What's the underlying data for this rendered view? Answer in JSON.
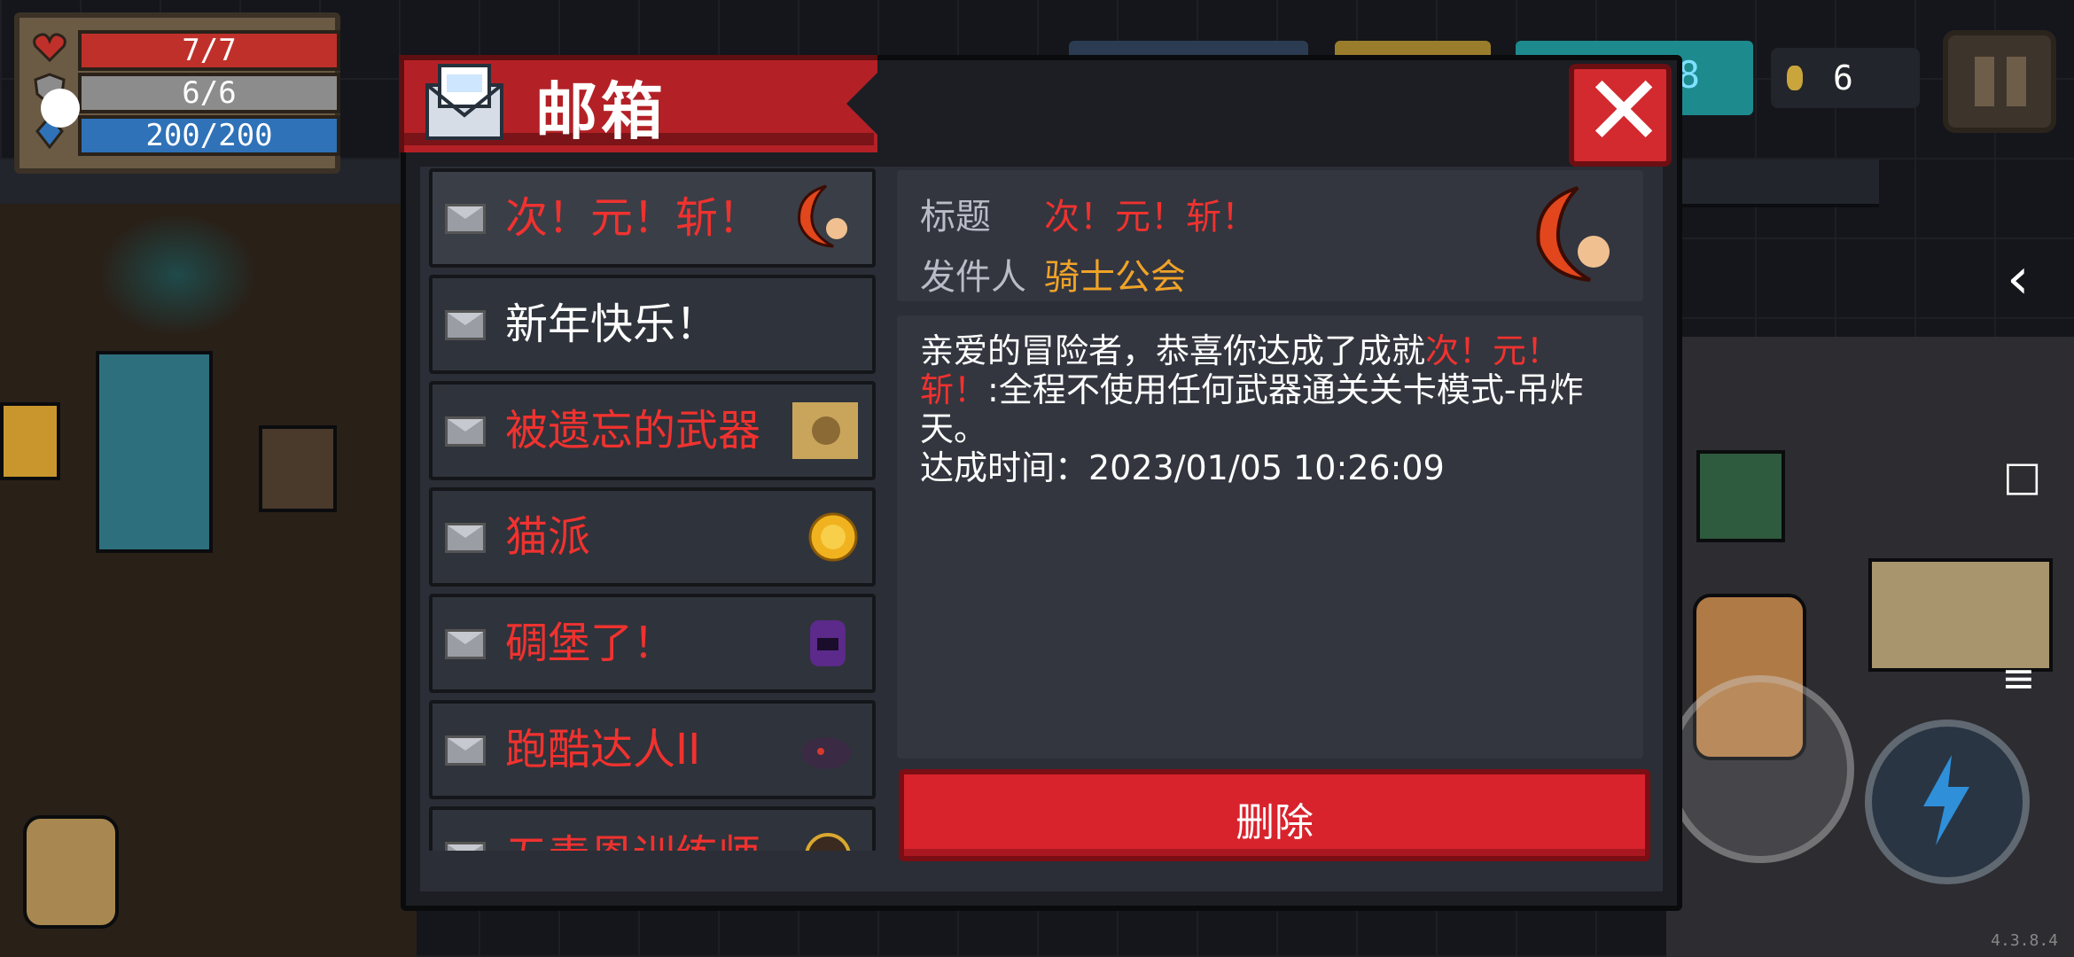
{
  "hud": {
    "hp": "7/7",
    "armor": "6/6",
    "energy": "200/200",
    "coins": "6",
    "partial_counter": "8",
    "hp_icon": "heart-icon",
    "armor_icon": "shield-icon",
    "energy_icon": "crystal-icon"
  },
  "mailbox": {
    "title": "邮箱",
    "close_label": "✕",
    "items": [
      {
        "label": "次！元！斩！",
        "color": "red",
        "icon": "crescent-slash-icon"
      },
      {
        "label": "新年快乐！",
        "color": "white",
        "icon": ""
      },
      {
        "label": "被遗忘的武器",
        "color": "red",
        "icon": "fist-scroll-icon"
      },
      {
        "label": "猫派",
        "color": "red",
        "icon": "gold-coin-icon"
      },
      {
        "label": "碉堡了！",
        "color": "red",
        "icon": "purple-monster-icon"
      },
      {
        "label": "跑酷达人II",
        "color": "red",
        "icon": "dark-monster-icon"
      },
      {
        "label": "五毒恩训练师",
        "color": "red",
        "icon": "gold-monster-icon"
      }
    ],
    "detail": {
      "title_label": "标题",
      "title_value": "次！元！斩！",
      "sender_label": "发件人",
      "sender_value": "骑士公会",
      "body_prefix": "亲爱的冒险者，恭喜你达成了成就",
      "body_highlight": "次！元！斩！",
      "body_suffix": ":全程不使用任何武器通关关卡模式-吊炸天。",
      "achieved_line": "达成时间：2023/01/05 10:26:09"
    },
    "delete_label": "删除"
  },
  "nav": {
    "back": "‹",
    "home": "□",
    "menu": "≡"
  },
  "version": "4.3.8.4",
  "colors": {
    "accent_red": "#d8232d",
    "header_red": "#b32126",
    "highlight_red": "#f0322f",
    "sender_orange": "#f0a328"
  }
}
